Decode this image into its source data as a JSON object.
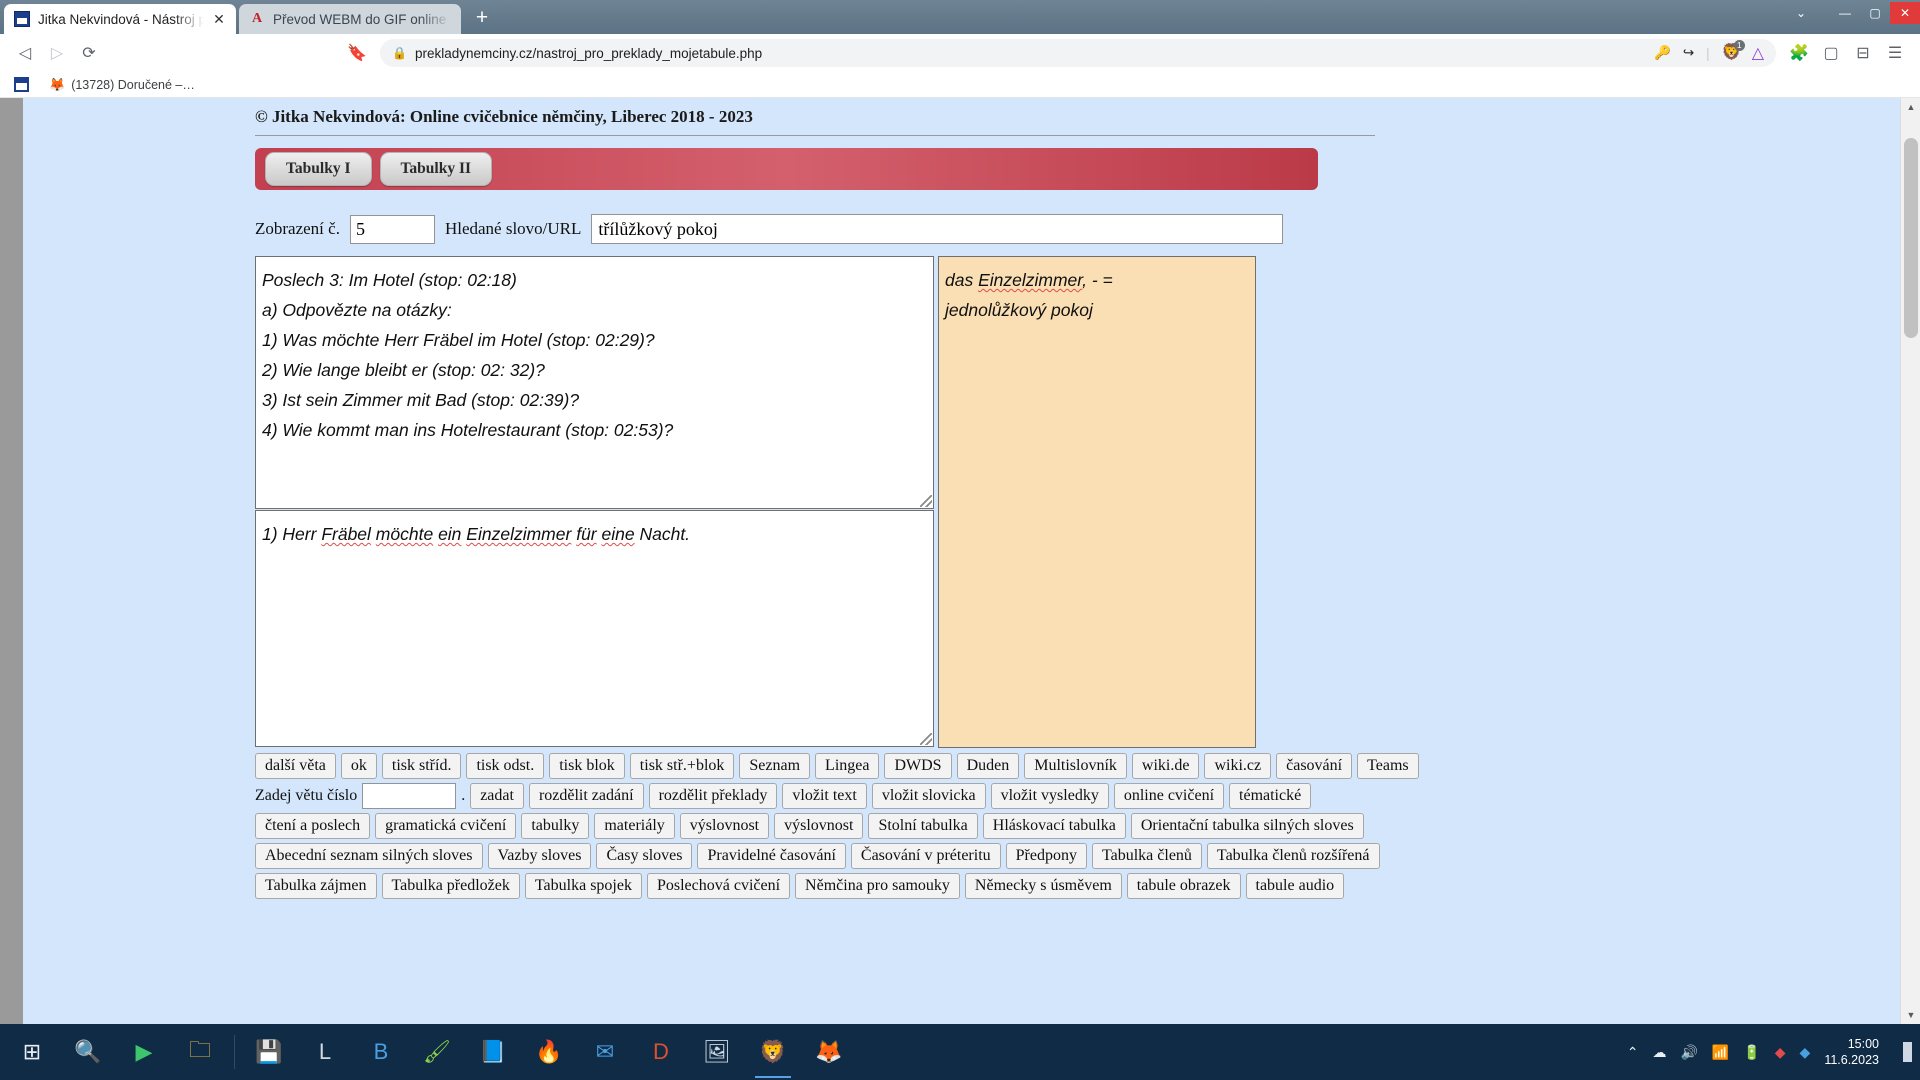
{
  "browser": {
    "tabs": [
      {
        "title": "Jitka Nekvindová - Nástroj pro pře",
        "icon": "site-favicon",
        "active": true,
        "close_label": "✕"
      },
      {
        "title": "Převod WEBM do GIF online zdarma -",
        "icon": "site-favicon",
        "active": false,
        "close_label": ""
      }
    ],
    "new_tab_label": "+",
    "window_controls": {
      "minimize": "—",
      "maximize": "▢",
      "close": "✕",
      "restore_down": "⌄"
    },
    "nav": {
      "back_icon": "back-arrow-icon",
      "forward_icon": "forward-arrow-icon",
      "reload_icon": "reload-icon",
      "bookmark_icon": "bookmark-icon",
      "lock_icon": "lock-icon",
      "url": "prekladynemciny.cz/nastroj_pro_preklady_mojetabule.php",
      "password_icon": "key-icon",
      "share_icon": "share-icon",
      "shield_icon": "brave-shield-icon",
      "shield_badge": "1",
      "brave_icon": "brave-lion-icon",
      "extensions_icon": "extensions-icon",
      "split_icon": "split-view-icon",
      "sidebar_icon": "sidebar-icon",
      "menu_icon": "hamburger-menu-icon"
    },
    "bookmarks": [
      {
        "label": "",
        "icon": "site-favicon"
      },
      {
        "label": "(13728) Doručené –…",
        "icon": "firefox-icon"
      }
    ]
  },
  "page": {
    "copyright": "© Jitka Nekvindová: Online cvičebnice němčiny, Liberec 2018 - 2023",
    "tabs": [
      {
        "label": "Tabulky I"
      },
      {
        "label": "Tabulky II"
      }
    ],
    "form": {
      "display_label": "Zobrazení č.",
      "display_value": "5",
      "search_label": "Hledané slovo/URL",
      "search_value": "třílůžkový pokoj"
    },
    "assignment_textarea": {
      "lines": [
        "Poslech 3: Im Hotel (stop: 02:18)",
        "a) Odpovězte na otázky:",
        "1) Was möchte Herr Fräbel im Hotel (stop: 02:29)?",
        "2) Wie lange bleibt er (stop: 02: 32)?",
        "3) Ist sein Zimmer mit Bad (stop: 02:39)?",
        "4) Wie kommt man ins Hotelrestaurant (stop: 02:53)?"
      ]
    },
    "answer_textarea": {
      "prefix": "1) Herr ",
      "tokens": [
        {
          "text": "Fräbel",
          "spell_error": true
        },
        {
          "text": " ",
          "spell_error": false
        },
        {
          "text": "möchte",
          "spell_error": true
        },
        {
          "text": " ",
          "spell_error": false
        },
        {
          "text": "ein",
          "spell_error": true
        },
        {
          "text": " ",
          "spell_error": false
        },
        {
          "text": "Einzelzimmer",
          "spell_error": true
        },
        {
          "text": " ",
          "spell_error": false
        },
        {
          "text": "für",
          "spell_error": true
        },
        {
          "text": " ",
          "spell_error": false
        },
        {
          "text": "eine",
          "spell_error": true
        },
        {
          "text": " Nacht.",
          "spell_error": false
        }
      ]
    },
    "vocab_pane": {
      "line1_a": "das ",
      "line1_b": "Einzelzimmer",
      "line1_c": ", - =",
      "line2": "jednolůžkový pokoj"
    },
    "button_rows": [
      {
        "type": "buttons",
        "buttons": [
          "další věta",
          "ok",
          "tisk stříd.",
          "tisk odst.",
          "tisk blok",
          "tisk stř.+blok",
          "Seznam",
          "Lingea",
          "DWDS",
          "Duden",
          "Multislovník",
          "wiki.de",
          "wiki.cz",
          "časování",
          "Teams"
        ]
      },
      {
        "type": "input-row",
        "label": "Zadej  větu  číslo",
        "input_value": "",
        "suffix": ".",
        "buttons": [
          "zadat",
          "rozdělit zadání",
          "rozdělit překlady",
          "vložit text",
          "vložit slovicka",
          "vložit vysledky",
          "online cvičení",
          "tématické"
        ]
      },
      {
        "type": "buttons",
        "buttons": [
          "čtení a poslech",
          "gramatická cvičení",
          "tabulky",
          "materiály",
          "výslovnost",
          "výslovnost",
          "Stolní tabulka",
          "Hláskovací tabulka",
          "Orientační tabulka silných sloves"
        ]
      },
      {
        "type": "buttons",
        "buttons": [
          "Abecední seznam silných sloves",
          "Vazby sloves",
          "Časy sloves",
          "Pravidelné časování",
          "Časování v préteritu",
          "Předpony",
          "Tabulka členů",
          "Tabulka členů rozšířená"
        ]
      },
      {
        "type": "buttons",
        "buttons": [
          "Tabulka zájmen",
          "Tabulka předložek",
          "Tabulka spojek",
          "Poslechová cvičení",
          "Němčina pro samouky",
          "Německy s úsměvem",
          "tabule obrazek",
          "tabule audio"
        ]
      }
    ]
  },
  "taskbar": {
    "items": [
      "start-icon",
      "search-icon",
      "media-player-icon",
      "folder-icon",
      "separator",
      "save-icon",
      "library-icon",
      "b-icon",
      "paint-icon",
      "reader-icon",
      "flame-icon",
      "mail-icon",
      "dictionary-icon",
      "photos-icon",
      "brave-icon",
      "firefox-icon"
    ],
    "tray": {
      "chevron": "⌃",
      "onedrive": "☁",
      "volume": "🔊",
      "network": "▮",
      "battery": "▭",
      "time": "15:00",
      "date": "11.6.2023",
      "notification": "▯"
    }
  },
  "colors": {
    "page_bg": "#d4e6fb",
    "tabbar_red": "#c2404f",
    "vocab_bg": "#fbdfb4",
    "spell_underline": "#e04b4b",
    "taskbar": "#0f2b45"
  }
}
